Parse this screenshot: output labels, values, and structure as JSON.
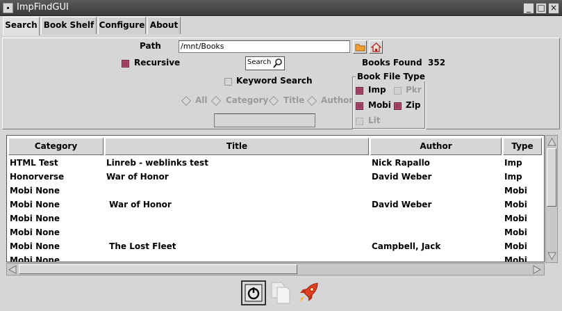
{
  "window": {
    "title": "ImpFindGUI"
  },
  "tabs": [
    {
      "label": "Search"
    },
    {
      "label": "Book Shelf"
    },
    {
      "label": "Configure"
    },
    {
      "label": "About"
    }
  ],
  "search": {
    "path_label": "Path",
    "path_value": "/mnt/Books",
    "recursive_label": "Recursive",
    "search_button": "Search",
    "books_found_label": "Books Found",
    "books_found_count": "352",
    "keyword_label": "Keyword Search",
    "filters": [
      "All",
      "Category",
      "Title",
      "Author"
    ],
    "keyword_value": "",
    "file_type_title": "Book File Type",
    "file_types": [
      {
        "label": "Imp",
        "checked": true,
        "enabled": true
      },
      {
        "label": "Pkr",
        "checked": false,
        "enabled": false
      },
      {
        "label": "Mobi",
        "checked": true,
        "enabled": true
      },
      {
        "label": "Zip",
        "checked": true,
        "enabled": true
      },
      {
        "label": "Lit",
        "checked": false,
        "enabled": false
      }
    ]
  },
  "table": {
    "columns": [
      "Category",
      "Title",
      "Author",
      "Type"
    ],
    "rows": [
      [
        "HTML Test",
        "Linreb - weblinks test",
        "Nick Rapallo",
        "Imp"
      ],
      [
        "Honorverse",
        "War of Honor",
        "David Weber",
        "Imp"
      ],
      [
        "Mobi None",
        "",
        "",
        "Mobi"
      ],
      [
        "Mobi None",
        " War of Honor",
        "David Weber",
        "Mobi"
      ],
      [
        "Mobi None",
        "",
        "",
        "Mobi"
      ],
      [
        "Mobi None",
        "",
        "",
        "Mobi"
      ],
      [
        "Mobi None",
        " The Lost Fleet",
        "Campbell, Jack",
        "Mobi"
      ],
      [
        "Mobi None",
        "",
        "",
        "Mobi"
      ]
    ]
  },
  "toolbar": {
    "icons": [
      "power-icon",
      "copy-icon",
      "rocket-icon"
    ]
  },
  "colors": {
    "checked": "#9a3d5e",
    "titlebar": "#4a4a4a"
  }
}
